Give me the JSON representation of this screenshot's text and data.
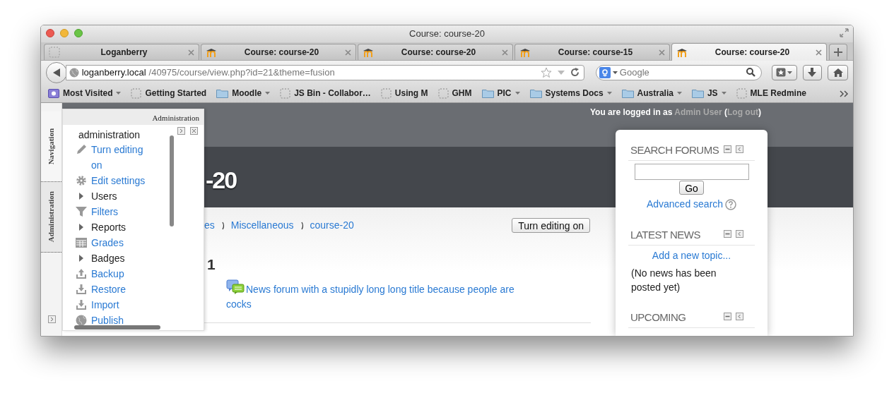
{
  "window": {
    "title": "Course: course-20"
  },
  "tabs": [
    {
      "label": "Loganberry",
      "kind": "page",
      "selected": false
    },
    {
      "label": "Course: course-20",
      "kind": "moodle",
      "selected": false
    },
    {
      "label": "Course: course-20",
      "kind": "moodle",
      "selected": false
    },
    {
      "label": "Course: course-15",
      "kind": "moodle",
      "selected": false
    },
    {
      "label": "Course: course-20",
      "kind": "moodle",
      "selected": true
    }
  ],
  "address_bar": {
    "host": "loganberry.local",
    "path": "/40975/course/view.php?id=21&theme=fusion"
  },
  "search_bar": {
    "placeholder": "Google"
  },
  "bookmarks": [
    {
      "label": "Most Visited",
      "kind": "smart",
      "dropdown": true
    },
    {
      "label": "Getting Started",
      "kind": "page",
      "dropdown": false
    },
    {
      "label": "Moodle",
      "kind": "folder",
      "dropdown": true
    },
    {
      "label": "JS Bin - Collabor…",
      "kind": "page",
      "dropdown": false
    },
    {
      "label": "Using M",
      "kind": "page",
      "dropdown": false
    },
    {
      "label": "GHM",
      "kind": "page",
      "dropdown": false
    },
    {
      "label": "PIC",
      "kind": "folder",
      "dropdown": true
    },
    {
      "label": "Systems Docs",
      "kind": "folder",
      "dropdown": true
    },
    {
      "label": "Australia",
      "kind": "folder",
      "dropdown": true
    },
    {
      "label": "JS",
      "kind": "folder",
      "dropdown": true
    },
    {
      "label": "MLE Redmine",
      "kind": "page",
      "dropdown": false
    }
  ],
  "dock": {
    "tabs": [
      {
        "label": "Navigation",
        "selected": false
      },
      {
        "label": "Administration",
        "selected": true
      }
    ]
  },
  "admin_panel": {
    "title": "Administration",
    "heading": "administration",
    "items": [
      {
        "label": "Turn editing on",
        "kind": "editing"
      },
      {
        "label": "Edit settings",
        "kind": "settings"
      },
      {
        "label": "Users",
        "kind": "branch"
      },
      {
        "label": "Filters",
        "kind": "filters"
      },
      {
        "label": "Reports",
        "kind": "branch"
      },
      {
        "label": "Grades",
        "kind": "grades"
      },
      {
        "label": "Badges",
        "kind": "branch"
      },
      {
        "label": "Backup",
        "kind": "backup"
      },
      {
        "label": "Restore",
        "kind": "restore"
      },
      {
        "label": "Import",
        "kind": "import"
      },
      {
        "label": "Publish",
        "kind": "publish"
      }
    ]
  },
  "login": {
    "before": "You are logged in as ",
    "user": "Admin User",
    "between": " (",
    "logout": "Log out",
    "after": ")"
  },
  "page_title": "-20",
  "breadcrumb": [
    "es",
    "Miscellaneous",
    "course-20"
  ],
  "edit_button": "Turn editing on",
  "section": {
    "title": "1",
    "activity": "News forum with a stupidly long long title because people are cocks"
  },
  "blocks": [
    {
      "kind": "search",
      "title": "SEARCH FORUMS",
      "button": "Go",
      "link": "Advanced search"
    },
    {
      "kind": "news",
      "title": "LATEST NEWS",
      "link": "Add a new topic...",
      "text": "(No news has been posted yet)"
    },
    {
      "kind": "events",
      "title": "UPCOMING"
    }
  ]
}
